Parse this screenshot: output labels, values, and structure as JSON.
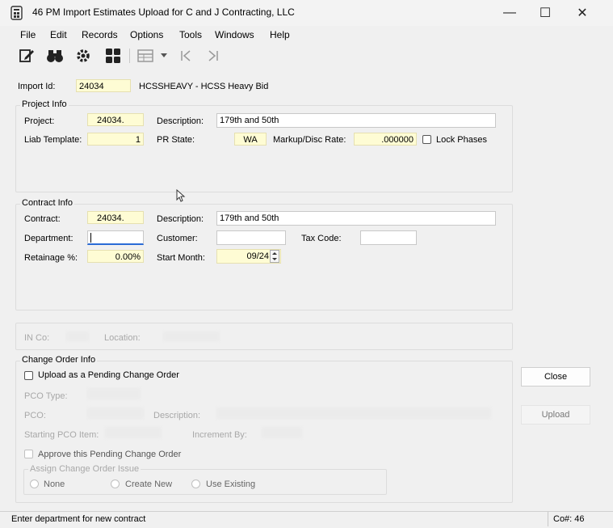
{
  "window": {
    "title": "46 PM Import Estimates Upload for C and J Contracting, LLC",
    "minimize_glyph": "—",
    "maximize_glyph": "☐",
    "close_glyph": "✕"
  },
  "menu": [
    "File",
    "Edit",
    "Records",
    "Options",
    "Tools",
    "Windows",
    "Help"
  ],
  "header": {
    "import_id_label": "Import Id:",
    "import_id_value": "24034",
    "import_desc": "HCSSHEAVY - HCSS Heavy Bid"
  },
  "project_info": {
    "title": "Project Info",
    "project_label": "Project:",
    "project_value": "24034.",
    "description_label": "Description:",
    "description_value": "179th and 50th",
    "liab_label": "Liab Template:",
    "liab_value": "1",
    "pr_state_label": "PR State:",
    "pr_state_value": "WA",
    "markup_label": "Markup/Disc Rate:",
    "markup_value": ".000000",
    "lock_phases_label": "Lock Phases"
  },
  "contract_info": {
    "title": "Contract Info",
    "contract_label": "Contract:",
    "contract_value": "24034.",
    "description_label": "Description:",
    "description_value": "179th and 50th",
    "department_label": "Department:",
    "department_value": "",
    "customer_label": "Customer:",
    "customer_value": "",
    "tax_code_label": "Tax Code:",
    "tax_code_value": "",
    "retainage_label": "Retainage %:",
    "retainage_value": "0.00%",
    "start_month_label": "Start Month:",
    "start_month_value": "09/24"
  },
  "in_section": {
    "in_co_label": "IN Co:",
    "location_label": "Location:"
  },
  "change_order": {
    "title": "Change Order Info",
    "upload_pending_label": "Upload as a Pending Change Order",
    "pco_type_label": "PCO Type:",
    "pco_label": "PCO:",
    "description_label": "Description:",
    "starting_pco_item_label": "Starting PCO Item:",
    "increment_by_label": "Increment By:",
    "approve_label": "Approve this Pending Change Order",
    "assign_title": "Assign Change Order Issue",
    "radio_none": "None",
    "radio_create": "Create New",
    "radio_existing": "Use Existing"
  },
  "buttons": {
    "close": "Close",
    "upload": "Upload"
  },
  "status": {
    "message": "Enter department for new contract",
    "company": "Co#: 46"
  },
  "colors": {
    "required_field": "#fefcd4",
    "window_bg": "#f0f0f0"
  }
}
